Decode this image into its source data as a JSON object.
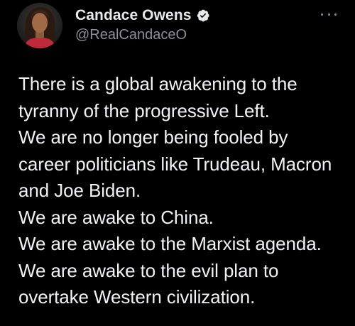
{
  "tweet": {
    "author": {
      "display_name": "Candace Owens",
      "handle": "@RealCandaceO",
      "verified_icon": "verified-badge-icon",
      "avatar": "profile-photo"
    },
    "more_icon": "more-horizontal-icon",
    "text_lines": [
      "There is a global awakening to the",
      "tyranny of the progressive Left.",
      "We are no longer being fooled by",
      "career politicians like Trudeau, Macron",
      "and Joe Biden.",
      "We are awake to China.",
      "We are awake to the Marxist agenda.",
      "We are awake to the evil plan to",
      "overtake Western civilization."
    ]
  },
  "colors": {
    "background": "#000000",
    "primary_text": "#e7e9ea",
    "secondary_text": "#8b9096"
  }
}
